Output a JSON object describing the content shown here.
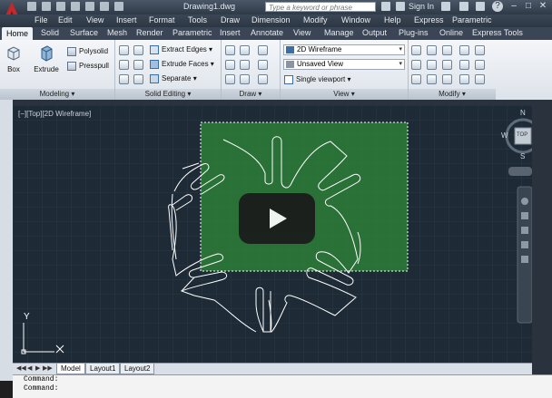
{
  "window": {
    "document_title": "Drawing1.dwg",
    "search_placeholder": "Type a keyword or phrase",
    "sign_in": "Sign In",
    "help_icon": "?"
  },
  "menu": [
    "File",
    "Edit",
    "View",
    "Insert",
    "Format",
    "Tools",
    "Draw",
    "Dimension",
    "Modify",
    "Window",
    "Help",
    "Express",
    "Parametric"
  ],
  "tabs": [
    "Home",
    "Solid",
    "Surface",
    "Mesh",
    "Render",
    "Parametric",
    "Insert",
    "Annotate",
    "View",
    "Manage",
    "Output",
    "Plug-ins",
    "Online",
    "Express Tools"
  ],
  "ribbon": {
    "modeling": {
      "title": "Modeling",
      "box": "Box",
      "extrude": "Extrude",
      "polysolid": "Polysolid",
      "presspull": "Presspull"
    },
    "solid_editing": {
      "title": "Solid Editing",
      "extract_edges": "Extract Edges",
      "extrude_faces": "Extrude Faces",
      "separate": "Separate"
    },
    "draw": {
      "title": "Draw"
    },
    "view": {
      "title": "View",
      "visual_style": "2D Wireframe",
      "saved_view": "Unsaved View",
      "viewport": "Single viewport"
    },
    "modify": {
      "title": "Modify"
    }
  },
  "viewport": {
    "label": "[−][Top][2D Wireframe]",
    "compass": {
      "n": "N",
      "s": "S",
      "w": "W",
      "top": "TOP"
    },
    "ucs_y": "Y",
    "ucs_x": "X"
  },
  "layout_tabs": [
    "Model",
    "Layout1",
    "Layout2"
  ],
  "command_lines": [
    "Command:",
    "Command:"
  ],
  "colors": {
    "canvas": "#1e2a36",
    "selection_fill": "#2f8a3a",
    "play_button": "#1a1a1a",
    "ribbon_bg": "#e8edf2"
  }
}
